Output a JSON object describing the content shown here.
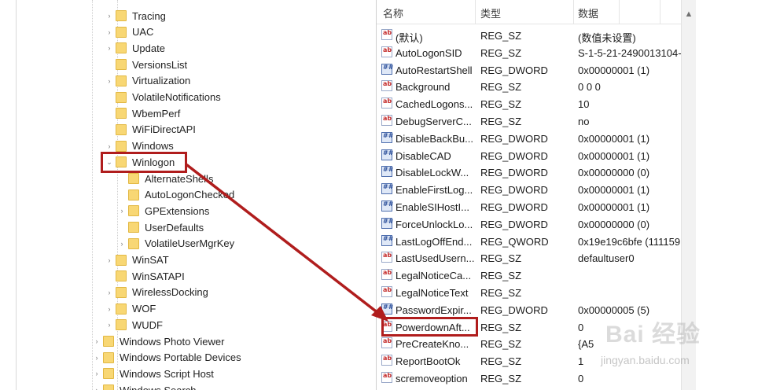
{
  "tree": {
    "nodes": [
      {
        "label": "Tracing",
        "expander": "›",
        "indent": 0
      },
      {
        "label": "UAC",
        "expander": "›",
        "indent": 0
      },
      {
        "label": "Update",
        "expander": "›",
        "indent": 0
      },
      {
        "label": "VersionsList",
        "expander": "",
        "indent": 0
      },
      {
        "label": "Virtualization",
        "expander": "›",
        "indent": 0
      },
      {
        "label": "VolatileNotifications",
        "expander": "",
        "indent": 0
      },
      {
        "label": "WbemPerf",
        "expander": "",
        "indent": 0
      },
      {
        "label": "WiFiDirectAPI",
        "expander": "",
        "indent": 0
      },
      {
        "label": "Windows",
        "expander": "›",
        "indent": 0
      },
      {
        "label": "Winlogon",
        "expander": "⌄",
        "indent": 0,
        "selected": true
      },
      {
        "label": "AlternateShells",
        "expander": "",
        "indent": 1
      },
      {
        "label": "AutoLogonChecked",
        "expander": "",
        "indent": 1
      },
      {
        "label": "GPExtensions",
        "expander": "›",
        "indent": 1
      },
      {
        "label": "UserDefaults",
        "expander": "",
        "indent": 1
      },
      {
        "label": "VolatileUserMgrKey",
        "expander": "›",
        "indent": 1
      },
      {
        "label": "WinSAT",
        "expander": "›",
        "indent": 0
      },
      {
        "label": "WinSATAPI",
        "expander": "",
        "indent": 0
      },
      {
        "label": "WirelessDocking",
        "expander": "›",
        "indent": 0
      },
      {
        "label": "WOF",
        "expander": "›",
        "indent": 0
      },
      {
        "label": "WUDF",
        "expander": "›",
        "indent": 0
      },
      {
        "label": "Windows Photo Viewer",
        "expander": "›",
        "indent": -1
      },
      {
        "label": "Windows Portable Devices",
        "expander": "›",
        "indent": -1
      },
      {
        "label": "Windows Script Host",
        "expander": "›",
        "indent": -1
      },
      {
        "label": "Windows Search",
        "expander": "›",
        "indent": -1
      }
    ]
  },
  "values": {
    "headers": {
      "name": "名称",
      "type": "类型",
      "data": "数据"
    },
    "rows": [
      {
        "name": "(默认)",
        "type": "REG_SZ",
        "data": "(数值未设置)",
        "icon": "sz"
      },
      {
        "name": "AutoLogonSID",
        "type": "REG_SZ",
        "data": "S-1-5-21-2490013104-",
        "icon": "sz"
      },
      {
        "name": "AutoRestartShell",
        "type": "REG_DWORD",
        "data": "0x00000001 (1)",
        "icon": "dw"
      },
      {
        "name": "Background",
        "type": "REG_SZ",
        "data": "0 0 0",
        "icon": "sz"
      },
      {
        "name": "CachedLogons...",
        "type": "REG_SZ",
        "data": "10",
        "icon": "sz"
      },
      {
        "name": "DebugServerC...",
        "type": "REG_SZ",
        "data": "no",
        "icon": "sz"
      },
      {
        "name": "DisableBackBu...",
        "type": "REG_DWORD",
        "data": "0x00000001 (1)",
        "icon": "dw"
      },
      {
        "name": "DisableCAD",
        "type": "REG_DWORD",
        "data": "0x00000001 (1)",
        "icon": "dw"
      },
      {
        "name": "DisableLockW...",
        "type": "REG_DWORD",
        "data": "0x00000000 (0)",
        "icon": "dw"
      },
      {
        "name": "EnableFirstLog...",
        "type": "REG_DWORD",
        "data": "0x00000001 (1)",
        "icon": "dw"
      },
      {
        "name": "EnableSIHostI...",
        "type": "REG_DWORD",
        "data": "0x00000001 (1)",
        "icon": "dw"
      },
      {
        "name": "ForceUnlockLo...",
        "type": "REG_DWORD",
        "data": "0x00000000 (0)",
        "icon": "dw"
      },
      {
        "name": "LastLogOffEnd...",
        "type": "REG_QWORD",
        "data": "0x19e19c6bfe (111159",
        "icon": "dw"
      },
      {
        "name": "LastUsedUsern...",
        "type": "REG_SZ",
        "data": "defaultuser0",
        "icon": "sz"
      },
      {
        "name": "LegalNoticeCa...",
        "type": "REG_SZ",
        "data": "",
        "icon": "sz"
      },
      {
        "name": "LegalNoticeText",
        "type": "REG_SZ",
        "data": "",
        "icon": "sz"
      },
      {
        "name": "PasswordExpir...",
        "type": "REG_DWORD",
        "data": "0x00000005 (5)",
        "icon": "dw"
      },
      {
        "name": "PowerdownAft...",
        "type": "REG_SZ",
        "data": "0",
        "icon": "sz",
        "highlighted": true
      },
      {
        "name": "PreCreateKno...",
        "type": "REG_SZ",
        "data": "{A5",
        "icon": "sz"
      },
      {
        "name": "ReportBootOk",
        "type": "REG_SZ",
        "data": "1",
        "icon": "sz"
      },
      {
        "name": "scremoveoption",
        "type": "REG_SZ",
        "data": "0",
        "icon": "sz"
      }
    ]
  },
  "watermark": {
    "logo": "Bai 经验",
    "url": "jingyan.baidu.com"
  },
  "colors": {
    "annotation": "#b01d1d",
    "folder": "#f8d774"
  }
}
